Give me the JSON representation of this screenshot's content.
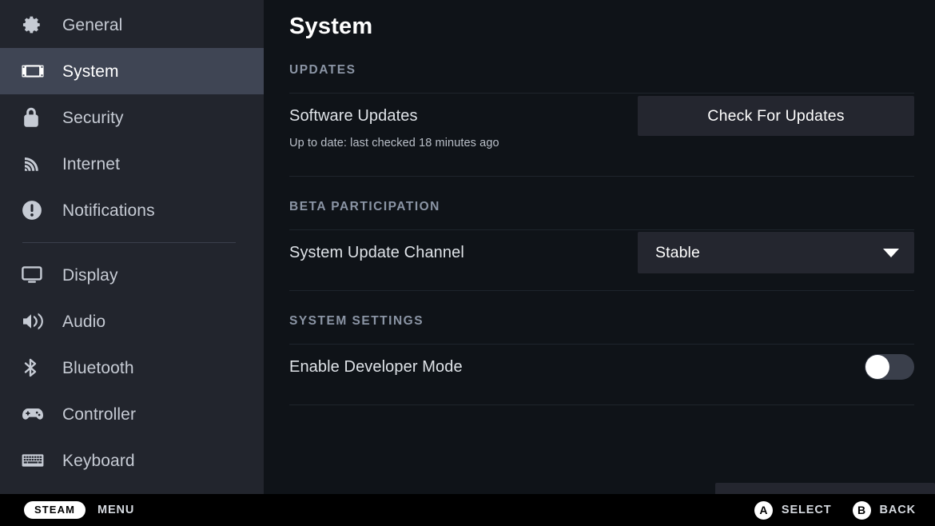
{
  "sidebar": {
    "groups": [
      {
        "items": [
          {
            "label": "General",
            "icon": "gear-icon",
            "selected": false
          },
          {
            "label": "System",
            "icon": "handheld-device-icon",
            "selected": true
          },
          {
            "label": "Security",
            "icon": "lock-icon",
            "selected": false
          },
          {
            "label": "Internet",
            "icon": "wifi-icon",
            "selected": false
          },
          {
            "label": "Notifications",
            "icon": "exclamation-circle-icon",
            "selected": false
          }
        ]
      },
      {
        "items": [
          {
            "label": "Display",
            "icon": "monitor-icon",
            "selected": false
          },
          {
            "label": "Audio",
            "icon": "speaker-icon",
            "selected": false
          },
          {
            "label": "Bluetooth",
            "icon": "bluetooth-icon",
            "selected": false
          },
          {
            "label": "Controller",
            "icon": "gamepad-icon",
            "selected": false
          },
          {
            "label": "Keyboard",
            "icon": "keyboard-icon",
            "selected": false
          }
        ]
      }
    ]
  },
  "main": {
    "title": "System",
    "sections": [
      {
        "header": "UPDATES",
        "rows": [
          {
            "label": "Software Updates",
            "control": "button",
            "button_label": "Check For Updates",
            "note": "Up to date: last checked 18 minutes ago"
          }
        ]
      },
      {
        "header": "BETA PARTICIPATION",
        "rows": [
          {
            "label": "System Update Channel",
            "control": "dropdown",
            "value": "Stable",
            "caret": "chevron-down-icon"
          }
        ]
      },
      {
        "header": "SYSTEM SETTINGS",
        "rows": [
          {
            "label": "Enable Developer Mode",
            "control": "toggle",
            "toggle_on": false
          }
        ]
      }
    ]
  },
  "footer": {
    "steam_pill": "STEAM",
    "menu_label": "MENU",
    "hints": [
      {
        "button": "A",
        "label": "SELECT"
      },
      {
        "button": "B",
        "label": "BACK"
      }
    ]
  },
  "colors": {
    "app_background": "#0f1318",
    "sidebar_background": "#22252d",
    "sidebar_selected": "#3f4554",
    "control_background": "#24262f",
    "section_header_text": "#8b95a5",
    "primary_text": "#ffffff",
    "body_text": "#dfe3e8",
    "divider": "#1e242c",
    "toggle_track_off": "#3a3f4b",
    "footer_background": "#000000"
  }
}
